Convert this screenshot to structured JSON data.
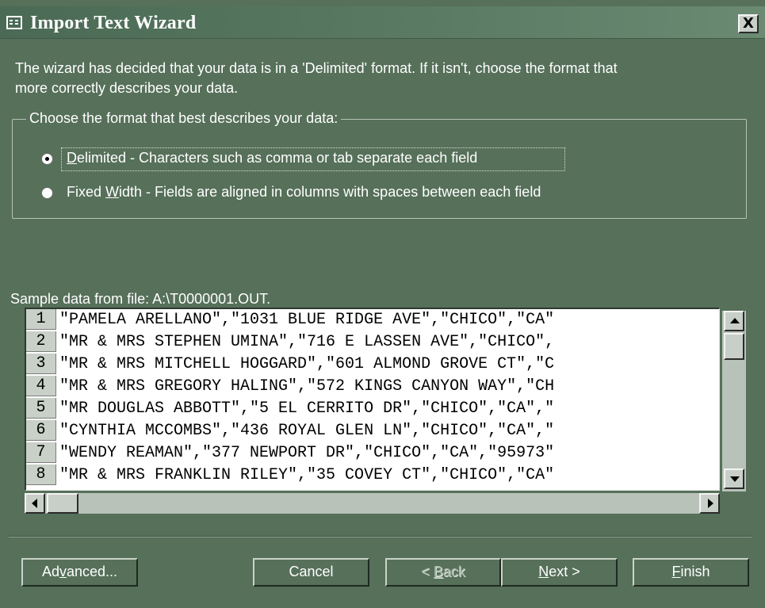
{
  "window": {
    "title": "Import Text Wizard",
    "close_glyph": "X",
    "icon": "table-icon"
  },
  "intro": {
    "line1": "The wizard has decided that your data is in a 'Delimited' format.  If it isn't, choose the format that",
    "line2": "more correctly describes your data."
  },
  "format_group": {
    "legend": "Choose the format that best describes your data:",
    "options": [
      {
        "label_pre": "",
        "label_key": "D",
        "label_post": "elimited - Characters such as comma or tab separate each field",
        "checked": true
      },
      {
        "label_pre": "Fixed ",
        "label_key": "W",
        "label_post": "idth - Fields are aligned in columns with spaces between each field",
        "checked": false
      }
    ]
  },
  "sample": {
    "label": "Sample data from file: A:\\T0000001.OUT.",
    "rows": [
      {
        "num": "1",
        "text": "\"PAMELA ARELLANO\",\"1031 BLUE RIDGE AVE\",\"CHICO\",\"CA\""
      },
      {
        "num": "2",
        "text": "\"MR & MRS STEPHEN UMINA\",\"716 E LASSEN AVE\",\"CHICO\","
      },
      {
        "num": "3",
        "text": "\"MR & MRS MITCHELL HOGGARD\",\"601 ALMOND GROVE CT\",\"C"
      },
      {
        "num": "4",
        "text": "\"MR & MRS GREGORY HALING\",\"572 KINGS CANYON WAY\",\"CH"
      },
      {
        "num": "5",
        "text": "\"MR DOUGLAS ABBOTT\",\"5 EL CERRITO DR\",\"CHICO\",\"CA\",\""
      },
      {
        "num": "6",
        "text": "\"CYNTHIA MCCOMBS\",\"436 ROYAL GLEN LN\",\"CHICO\",\"CA\",\""
      },
      {
        "num": "7",
        "text": "\"WENDY REAMAN\",\"377 NEWPORT DR\",\"CHICO\",\"CA\",\"95973\""
      },
      {
        "num": "8",
        "text": "\"MR & MRS FRANKLIN RILEY\",\"35 COVEY CT\",\"CHICO\",\"CA\""
      }
    ]
  },
  "buttons": {
    "advanced": {
      "pre": "Ad",
      "key": "v",
      "post": "anced..."
    },
    "cancel": "Cancel",
    "back": {
      "pre": "< ",
      "key": "B",
      "post": "ack",
      "disabled": true
    },
    "next": {
      "pre": "",
      "key": "N",
      "post": "ext >"
    },
    "finish": {
      "pre": "",
      "key": "F",
      "post": "inish"
    }
  },
  "colors": {
    "dialog_background": "#56705a",
    "text": "#ffffff",
    "grid_background": "#ffffff"
  }
}
